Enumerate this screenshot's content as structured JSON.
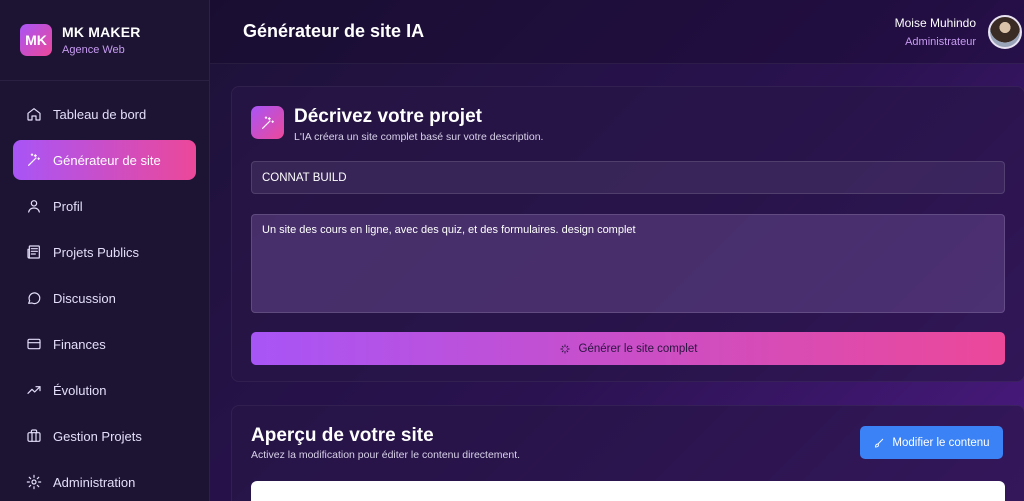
{
  "brand": {
    "logo": "MK",
    "name": "MK MAKER",
    "subtitle": "Agence Web"
  },
  "sidebar": {
    "items": [
      {
        "label": "Tableau de bord",
        "icon": "home-icon"
      },
      {
        "label": "Générateur de site",
        "icon": "magic-wand-icon",
        "active": true
      },
      {
        "label": "Profil",
        "icon": "user-icon"
      },
      {
        "label": "Projets Publics",
        "icon": "newspaper-icon"
      },
      {
        "label": "Discussion",
        "icon": "chat-icon"
      },
      {
        "label": "Finances",
        "icon": "credit-card-icon"
      },
      {
        "label": "Évolution",
        "icon": "trending-up-icon"
      },
      {
        "label": "Gestion Projets",
        "icon": "briefcase-icon"
      },
      {
        "label": "Administration",
        "icon": "gear-icon"
      }
    ]
  },
  "header": {
    "title": "Générateur de site IA",
    "user_name": "Moise Muhindo",
    "user_role": "Administrateur"
  },
  "generator": {
    "title": "Décrivez votre projet",
    "subtitle": "L'IA créera un site complet basé sur votre description.",
    "name_value": "CONNAT BUILD",
    "description_value": "Un site des cours en ligne, avec des quiz, et des formulaires. design complet",
    "generate_label": "Générer le site complet"
  },
  "preview": {
    "title": "Aperçu de votre site",
    "subtitle": "Activez la modification pour éditer le contenu directement.",
    "edit_label": "Modifier le contenu"
  },
  "colors": {
    "accent_start": "#a855f7",
    "accent_end": "#ec4899",
    "edit_button": "#3b82f6"
  }
}
